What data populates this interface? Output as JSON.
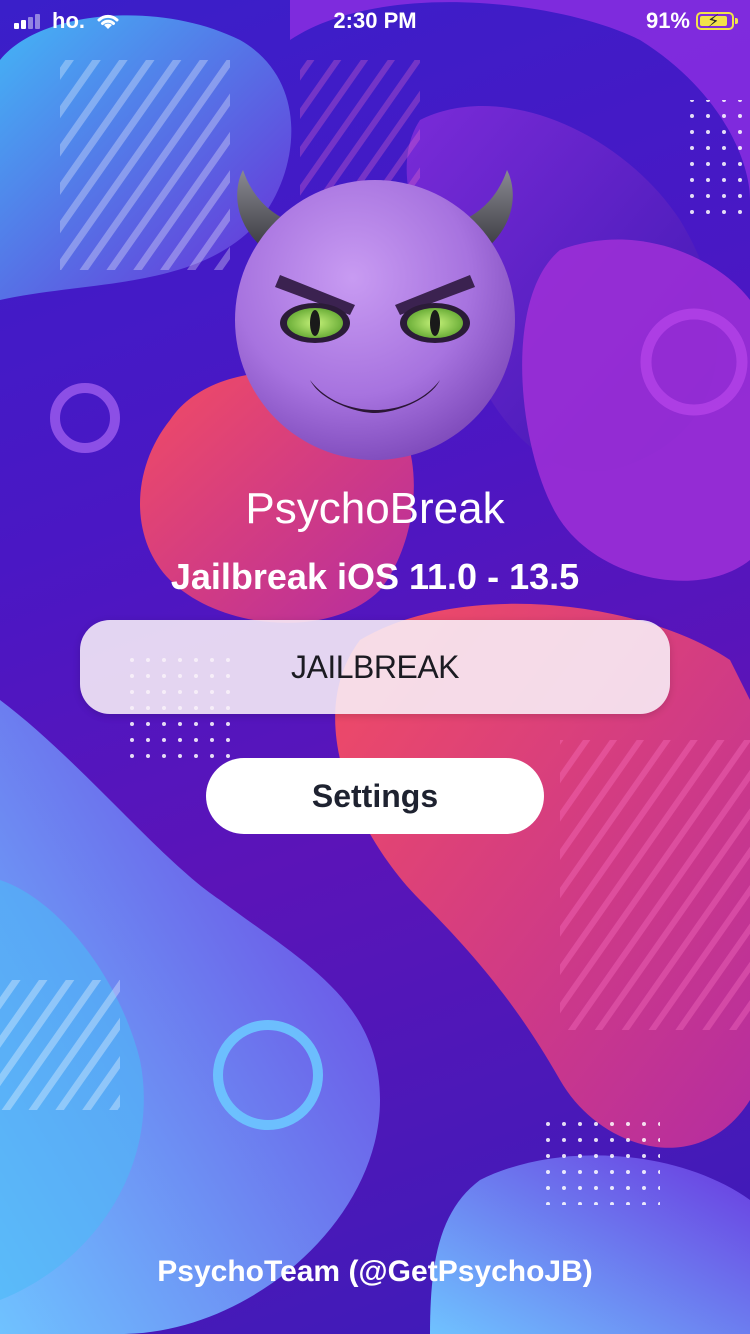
{
  "status_bar": {
    "carrier": "ho.",
    "time": "2:30 PM",
    "battery_percent": "91%",
    "battery_level": 0.91,
    "icons": [
      "signal-icon",
      "wifi-icon",
      "battery-charging-icon"
    ]
  },
  "app": {
    "title": "PsychoBreak",
    "subtitle": "Jailbreak iOS 11.0 - 13.5",
    "logo_icon": "smiling-devil-emoji-icon"
  },
  "buttons": {
    "jailbreak_label": "JAILBREAK",
    "settings_label": "Settings"
  },
  "footer": {
    "credit": "PsychoTeam (@GetPsychoJB)"
  },
  "colors": {
    "background_primary": "#4a17c4",
    "accent_pink": "#e8356d",
    "accent_blue": "#3aa8f5",
    "text": "#ffffff"
  }
}
